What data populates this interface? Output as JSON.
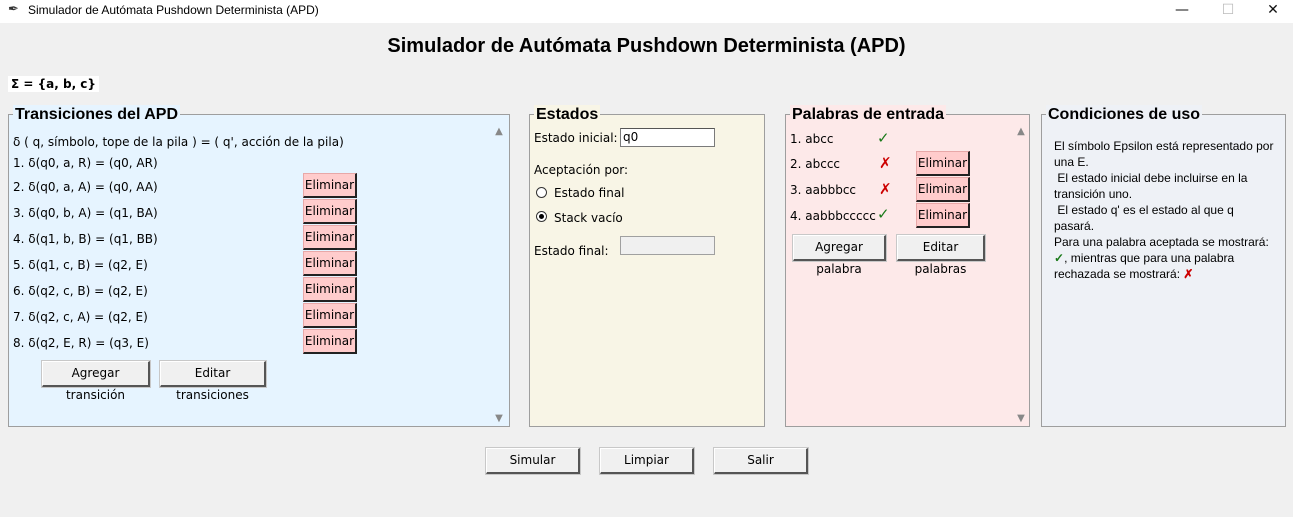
{
  "window": {
    "title": "Simulador de Autómata Pushdown Determinista (APD)",
    "min_icon": "minimize-icon",
    "max_icon": "maximize-icon",
    "close_icon": "close-icon"
  },
  "heading": "Simulador de Autómata Pushdown Determinista (APD)",
  "alphabet": "Σ = {a, b, c}",
  "transitions": {
    "title": "Transiciones del APD",
    "header": "δ ( q, símbolo, tope de la pila ) = ( q', acción de la pila)",
    "items": [
      "1. δ(q0, a, R) = (q0, AR)",
      "2. δ(q0, a, A) = (q0, AA)",
      "3. δ(q0, b, A) = (q1, BA)",
      "4. δ(q1, b, B) = (q1, BB)",
      "5. δ(q1, c, B) = (q2, E)",
      "6. δ(q2, c, B) = (q2, E)",
      "7. δ(q2, c, A) = (q2, E)",
      "8. δ(q2, E, R) = (q3, E)"
    ],
    "delete_label": "Eliminar",
    "add_label": "Agregar transición",
    "edit_label": "Editar transiciones",
    "bg_color": "#e6f4ff"
  },
  "states": {
    "title": "Estados",
    "initial_label": "Estado inicial:",
    "initial_value": "q0",
    "acceptance_label": "Aceptación por:",
    "option_final": "Estado final",
    "option_stack": "Stack vacío",
    "selected": "Stack vacío",
    "final_label": "Estado final:",
    "final_value": "",
    "bg_color": "#f8f5e6"
  },
  "words": {
    "title": "Palabras de entrada",
    "items": [
      {
        "label": "1. abcc",
        "result": "✓",
        "accepted": true
      },
      {
        "label": "2. abccc",
        "result": "✗",
        "accepted": false
      },
      {
        "label": "3. aabbbcc",
        "result": "✗",
        "accepted": false
      },
      {
        "label": "4. aabbbccccc",
        "result": "✓",
        "accepted": true
      }
    ],
    "delete_label": "Eliminar",
    "add_label": "Agregar palabra",
    "edit_label": "Editar palabras",
    "accept_color": "#1a7a1a",
    "reject_color": "#cc0000",
    "bg_color": "#fde9e9"
  },
  "conditions": {
    "title": "Condiciones de uso",
    "lines": [
      "El símbolo Epsilon está representado por una E.",
      " El estado inicial debe incluirse en la transición uno.",
      " El estado q' es el estado al que q pasará."
    ],
    "last_part1": "Para una palabra aceptada se mostrará: ",
    "check": "✓",
    "last_part2": ", mientras que para una palabra rechazada se mostrará: ",
    "cross": "✗",
    "bg_color": "#eef1f6"
  },
  "bottom": {
    "simulate_label": "Simular",
    "clear_label": "Limpiar",
    "exit_label": "Salir"
  }
}
